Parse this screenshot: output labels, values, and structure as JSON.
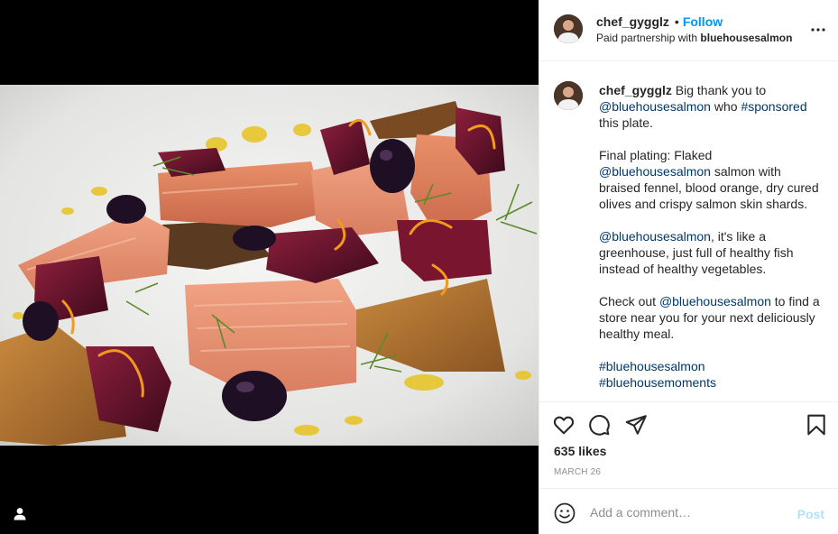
{
  "post": {
    "username": "chef_gygglz",
    "follow_label": "Follow",
    "dot": "•",
    "partnership_prefix": "Paid partnership with",
    "partner": "bluehousesalmon"
  },
  "media": {
    "alt": "Plated salmon dish with beets, blood orange, olives and crispy skin",
    "tag_icon": "user-tag-icon"
  },
  "caption": {
    "username": "chef_gygglz",
    "p1_text1": " Big thank you to ",
    "p1_mention": "@bluehousesalmon",
    "p1_text2": " who ",
    "p1_hashtag": "#sponsored",
    "p1_text3": " this plate.",
    "p2_text1": "Final plating: Flaked ",
    "p2_mention": "@bluehousesalmon",
    "p2_text2": " salmon with braised fennel, blood orange, dry cured olives and crispy salmon skin shards.",
    "p3_mention": "@bluehousesalmon",
    "p3_text1": ", it's like a greenhouse, just full of healthy fish instead of healthy vegetables.",
    "p4_text1": "Check out ",
    "p4_mention": "@bluehousesalmon",
    "p4_text2": " to find a store near you for your next deliciously healthy meal.",
    "hashtag1": "#bluehousesalmon",
    "hashtag2": "#bluehousemoments"
  },
  "actions": {
    "icons": [
      "heart-icon",
      "comment-icon",
      "share-icon",
      "bookmark-icon"
    ],
    "likes": "635 likes",
    "date": "MARCH 26"
  },
  "add_comment": {
    "placeholder": "Add a comment…",
    "post_label": "Post",
    "emoji_icon": "emoji-icon"
  },
  "colors": {
    "link": "#00376b",
    "follow": "#0095f6",
    "post_disabled": "#b2dffc",
    "muted": "#8e8e8e"
  }
}
